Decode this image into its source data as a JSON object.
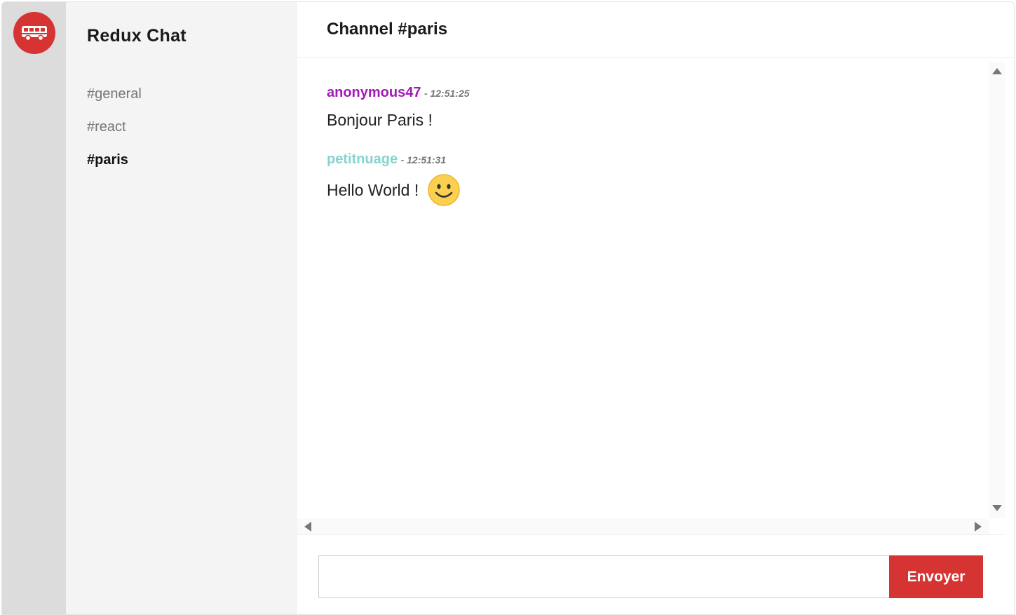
{
  "app": {
    "title": "Redux Chat",
    "logo_icon": "bus-icon",
    "logo_color": "#d63333"
  },
  "sidebar": {
    "channels": [
      {
        "label": "#general",
        "active": false
      },
      {
        "label": "#react",
        "active": false
      },
      {
        "label": "#paris",
        "active": true
      }
    ]
  },
  "main": {
    "title": "Channel #paris",
    "messages": [
      {
        "author": "anonymous47",
        "author_color": "#a01ab5",
        "time": "- 12:51:25",
        "text": "Bonjour Paris !",
        "emoji": ""
      },
      {
        "author": "petitnuage",
        "author_color": "#86d3cf",
        "time": "- 12:51:31",
        "text": "Hello World !",
        "emoji": "smiley-face-icon"
      }
    ]
  },
  "composer": {
    "value": "",
    "placeholder": "",
    "send_label": "Envoyer",
    "accent": "#d63333"
  }
}
